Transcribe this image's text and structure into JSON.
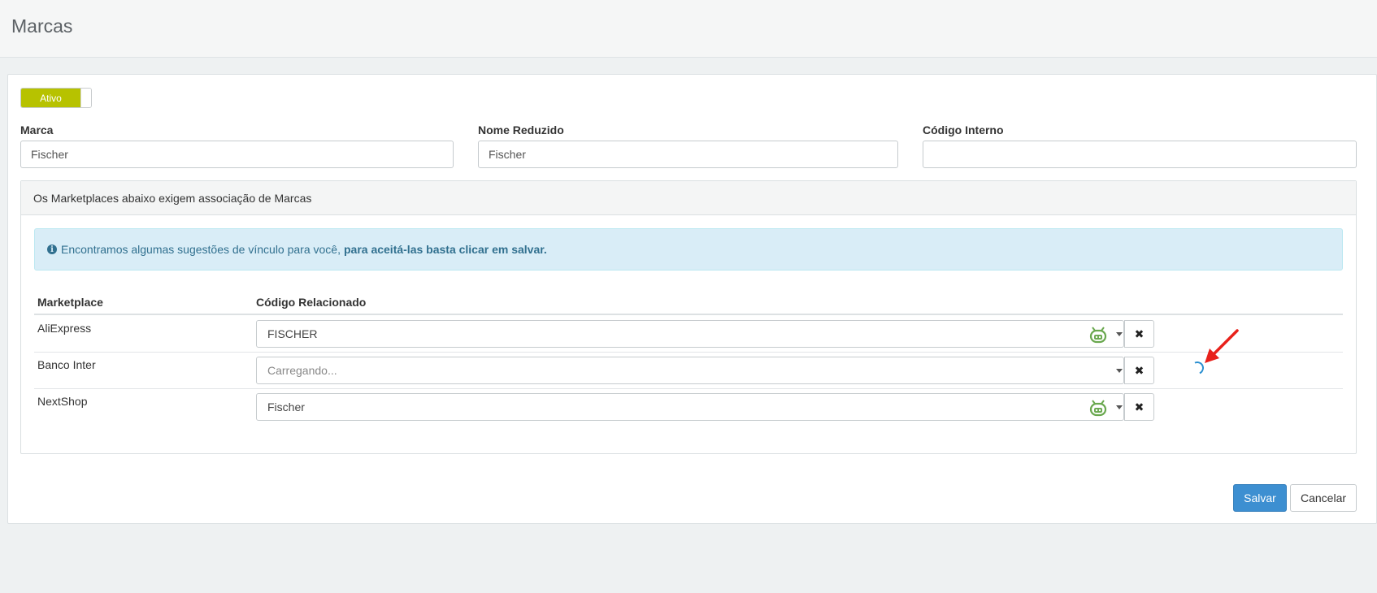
{
  "page": {
    "title": "Marcas"
  },
  "status_toggle": {
    "label": "Ativo",
    "on": true,
    "color": "#b7c200"
  },
  "form": {
    "marca": {
      "label": "Marca",
      "value": "Fischer"
    },
    "nome_reduzido": {
      "label": "Nome Reduzido",
      "value": "Fischer"
    },
    "codigo_interno": {
      "label": "Código Interno",
      "value": ""
    }
  },
  "marketplaces_panel": {
    "heading": "Os Marketplaces abaixo exigem associação de Marcas",
    "alert": {
      "icon": "info-circle-icon",
      "text": "Encontramos algumas sugestões de vínculo para você,",
      "bold_text": "para aceitá-las basta clicar em salvar."
    },
    "columns": [
      "Marketplace",
      "Código Relacionado"
    ],
    "rows": [
      {
        "marketplace": "AliExpress",
        "code": "FISCHER",
        "loading": false,
        "suggested_icon": "robot-icon"
      },
      {
        "marketplace": "Banco Inter",
        "code": "Carregando...",
        "loading": true,
        "suggested_icon": ""
      },
      {
        "marketplace": "NextShop",
        "code": "Fischer",
        "loading": false,
        "suggested_icon": "robot-icon"
      }
    ]
  },
  "actions": {
    "save_label": "Salvar",
    "cancel_label": "Cancelar",
    "save_color": "#3d8fd1"
  }
}
